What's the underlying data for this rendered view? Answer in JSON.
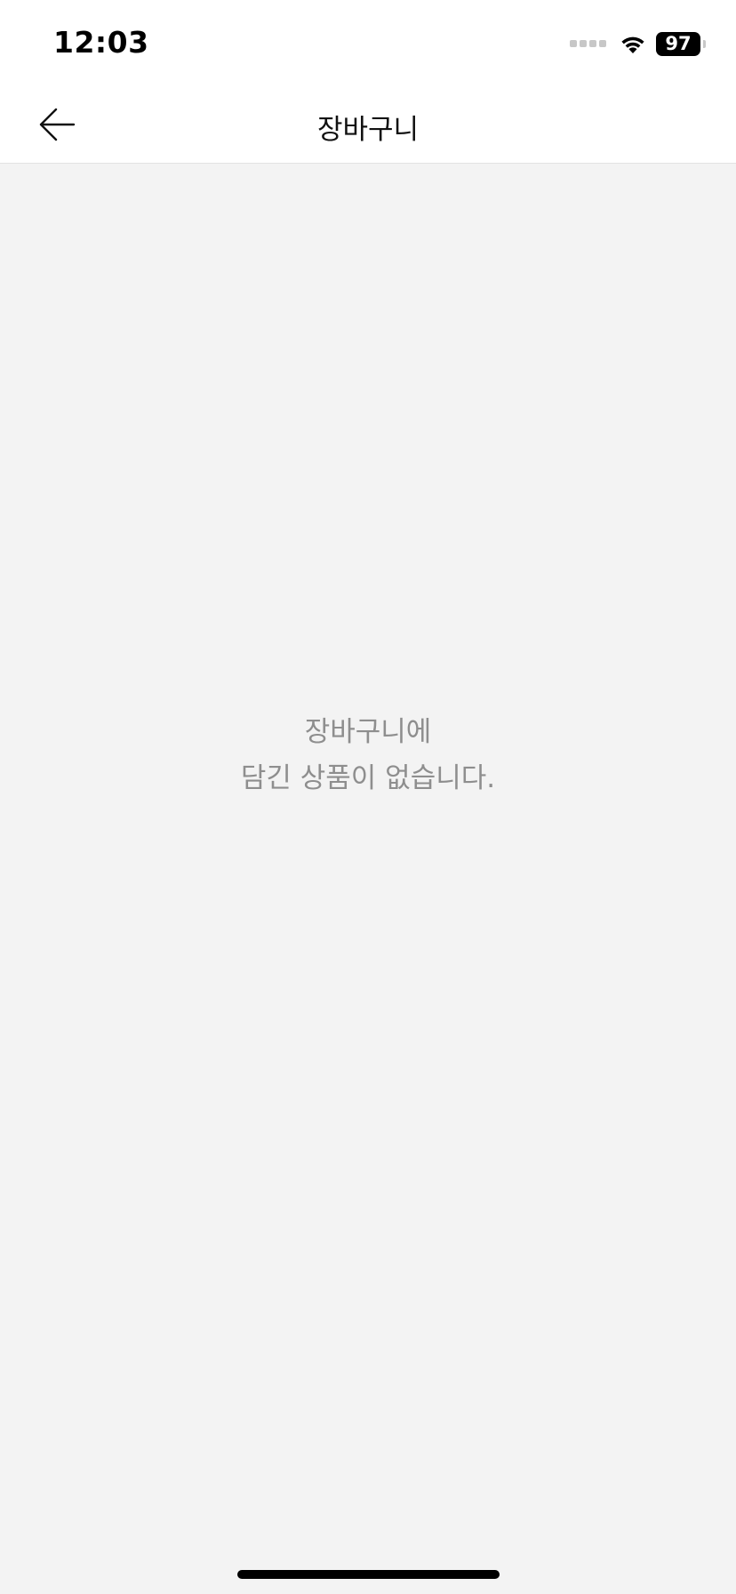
{
  "status_bar": {
    "time": "12:03",
    "battery_level": "97",
    "icons": [
      "signal-icon",
      "wifi-icon",
      "battery-icon"
    ]
  },
  "nav": {
    "title": "장바구니",
    "back_icon": "arrow-left-icon"
  },
  "empty_state": {
    "line1": "장바구니에",
    "line2": "담긴 상품이 없습니다."
  },
  "colors": {
    "background": "#f3f3f3",
    "header_background": "#ffffff",
    "empty_text": "#8e8e8e",
    "title_text": "#111111"
  }
}
